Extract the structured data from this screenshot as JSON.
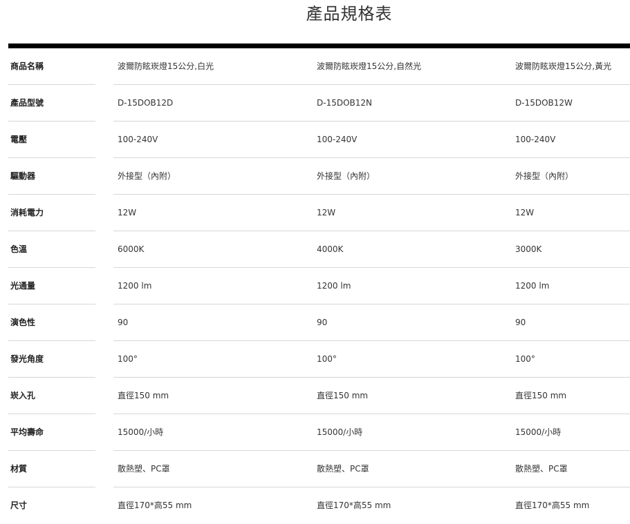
{
  "title": "產品規格表",
  "rows": [
    {
      "label": "商品名稱",
      "values": [
        "波爾防眩崁燈15公分,白光",
        "波爾防眩崁燈15公分,自然光",
        "波爾防眩崁燈15公分,黃光"
      ]
    },
    {
      "label": "產品型號",
      "values": [
        "D-15DOB12D",
        "D-15DOB12N",
        "D-15DOB12W"
      ]
    },
    {
      "label": "電壓",
      "values": [
        "100-240V",
        "100-240V",
        "100-240V"
      ]
    },
    {
      "label": "驅動器",
      "values": [
        "外接型（內附）",
        "外接型（內附）",
        "外接型（內附）"
      ]
    },
    {
      "label": "消耗電力",
      "values": [
        "12W",
        "12W",
        "12W"
      ]
    },
    {
      "label": "色溫",
      "values": [
        "6000K",
        "4000K",
        "3000K"
      ]
    },
    {
      "label": "光通量",
      "values": [
        "1200 lm",
        "1200 lm",
        "1200 lm"
      ]
    },
    {
      "label": "演色性",
      "values": [
        "90",
        "90",
        "90"
      ]
    },
    {
      "label": "發光角度",
      "values": [
        "100°",
        "100°",
        "100°"
      ]
    },
    {
      "label": "崁入孔",
      "values": [
        "直徑150 mm",
        "直徑150 mm",
        "直徑150 mm"
      ]
    },
    {
      "label": "平均壽命",
      "values": [
        "15000/小時",
        "15000/小時",
        "15000/小時"
      ]
    },
    {
      "label": "材質",
      "values": [
        "散熱塑、PC罩",
        "散熱塑、PC罩",
        "散熱塑、PC罩"
      ]
    },
    {
      "label": "尺寸",
      "values": [
        "直徑170*高55 mm",
        "直徑170*高55 mm",
        "直徑170*高55 mm"
      ]
    }
  ]
}
